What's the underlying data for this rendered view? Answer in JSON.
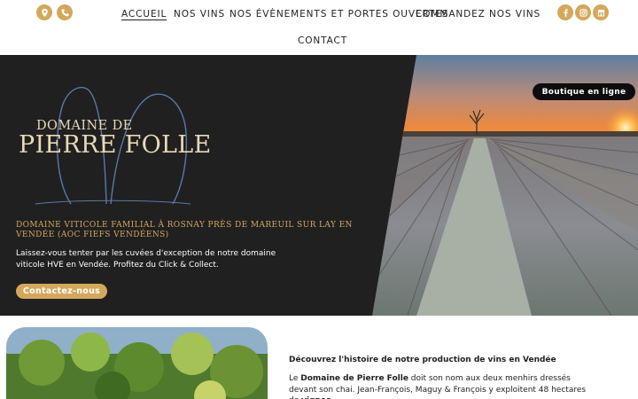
{
  "header": {
    "contact_icons": [
      "map-pin-icon",
      "phone-icon"
    ],
    "nav": [
      "ACCUEIL",
      "NOS VINS",
      "NOS ÉVÈNEMENTS ET PORTES OUVERTES",
      "COMMANDEZ NOS VINS",
      "CONTACT"
    ],
    "active_nav": "ACCUEIL",
    "social_icons": [
      "facebook-icon",
      "instagram-icon",
      "store-icon"
    ]
  },
  "hero": {
    "brand_line1": "DOMAINE DE",
    "brand_line2": "PIERRE FOLLE",
    "tagline": "DOMAINE VITICOLE FAMILIAL À ROSNAY PRÈS DE MAREUIL SUR LAY EN VENDÉE (AOC FIEFS VENDÉENS)",
    "intro": "Laissez-vous tenter par les cuvées d'exception de notre domaine viticole HVE en Vendée. Profitez du Click & Collect.",
    "cta_label": "Contactez-nous",
    "shop_label": "Boutique en ligne"
  },
  "section": {
    "title": "Découvrez l'histoire de notre production de vins en Vendée",
    "body_pre": "Le ",
    "body_bold1": "Domaine de Pierre Folle",
    "body_mid": " doit son nom aux deux menhirs dressés devant son chai. Jean-François, Maguy & François y exploitent 48 hectares de ",
    "body_bold2": "vignes"
  },
  "colors": {
    "accent": "#d4a85c",
    "hero_bg": "#202020",
    "brand_text": "#e8d9b6",
    "text": "#1f1f1f"
  }
}
